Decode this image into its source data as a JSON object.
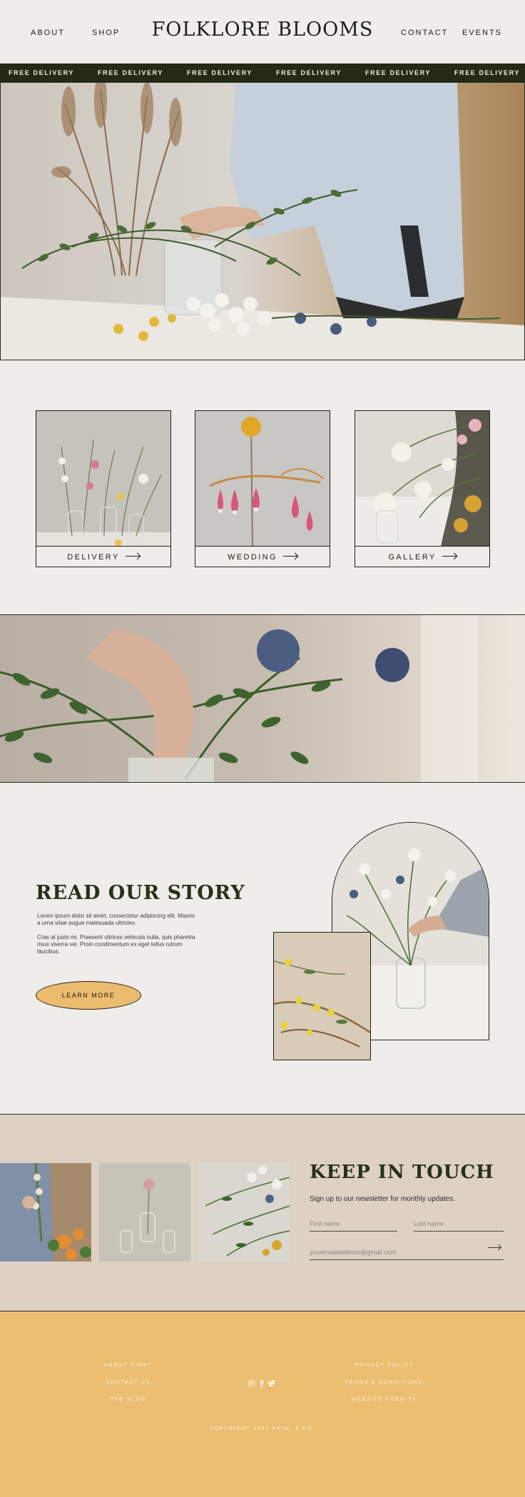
{
  "header": {
    "logo": "FOLKLORE BLOOMS",
    "nav_left": [
      "ABOUT",
      "SHOP"
    ],
    "nav_right": [
      "CONTACT",
      "EVENTS"
    ]
  },
  "delivery_band": {
    "items": [
      "FREE DELIVERY",
      "FREE DELIVERY",
      "FREE DELIVERY",
      "FREE DELIVERY",
      "FREE DELIVERY",
      "FREE DELIVERY"
    ]
  },
  "cards": [
    {
      "label": "DELIVERY",
      "icon": "arrow-right-icon"
    },
    {
      "label": "WEDDING",
      "icon": "arrow-right-icon"
    },
    {
      "label": "GALLERY",
      "icon": "arrow-right-icon"
    }
  ],
  "story": {
    "title": "READ OUR STORY",
    "paragraph_1": "Lorem ipsum dolor sit amet, consectetur adipiscing elit. Mauris a urna vitae augue malesuada ultricies.",
    "paragraph_2": "Cras at justo mi. Praesent ultrices vehicula nulla, quis pharetra risus viverra vel. Proin condimentum ex eget tellus rutrum faucibus.",
    "button": "LEARN MORE"
  },
  "keep_in_touch": {
    "title": "KEEP IN TOUCH",
    "subtitle": "Sign up to our newsletter for monthly updates.",
    "first_name_placeholder": "First name",
    "last_name_placeholder": "Last name",
    "email_placeholder": "youremailaddress@gmail.com",
    "submit_icon": "arrow-right-icon"
  },
  "footer": {
    "left_links": [
      "ABOUT GINNY",
      "CONTACT US",
      "THE BLOG"
    ],
    "right_links": [
      "PRIVACY POLICY",
      "TERMS & CONDITIONS",
      "WEBSITE CREDITS"
    ],
    "social_icons": [
      "instagram-icon",
      "facebook-icon",
      "twitter-icon"
    ],
    "copyright": "COPYRIGHT 2022 ANIAL & CO."
  },
  "colors": {
    "background": "#efedea",
    "band": "#232a15",
    "accent": "#ebbc6d",
    "kit_background": "#ddd1c4",
    "footer": "#ebbe72",
    "heading": "#283018"
  }
}
